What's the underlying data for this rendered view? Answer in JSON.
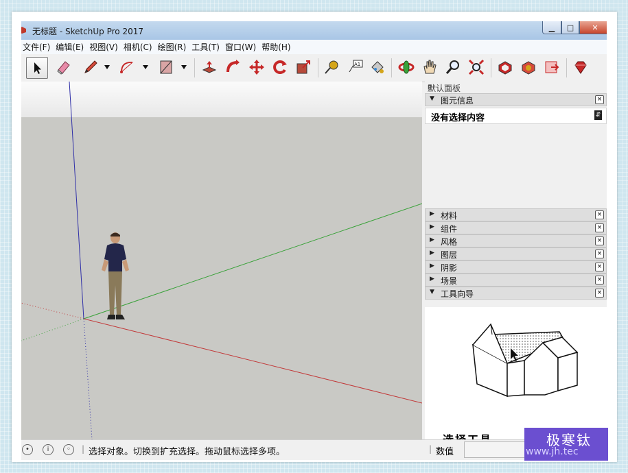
{
  "window": {
    "title": "无标题 - SketchUp Pro 2017"
  },
  "menu": [
    "文件(F)",
    "编辑(E)",
    "视图(V)",
    "相机(C)",
    "绘图(R)",
    "工具(T)",
    "窗口(W)",
    "帮助(H)"
  ],
  "tray": {
    "title": "默认面板",
    "entity_info": {
      "label": "图元信息",
      "content": "没有选择内容"
    },
    "panels": [
      "材料",
      "组件",
      "风格",
      "图层",
      "阴影",
      "场景",
      "工具向导"
    ],
    "instructor_title": "选择工具"
  },
  "status": {
    "message": "选择对象。切换到扩充选择。拖动鼠标选择多项。",
    "value_label": "数值"
  },
  "watermark": {
    "brand": "极寒钛",
    "url": "www.jh.tec"
  },
  "colors": {
    "axis_blue": "#2f2fa8",
    "axis_green": "#3aa23a",
    "axis_red": "#c23a3a",
    "ground": "#c9c9c5"
  }
}
